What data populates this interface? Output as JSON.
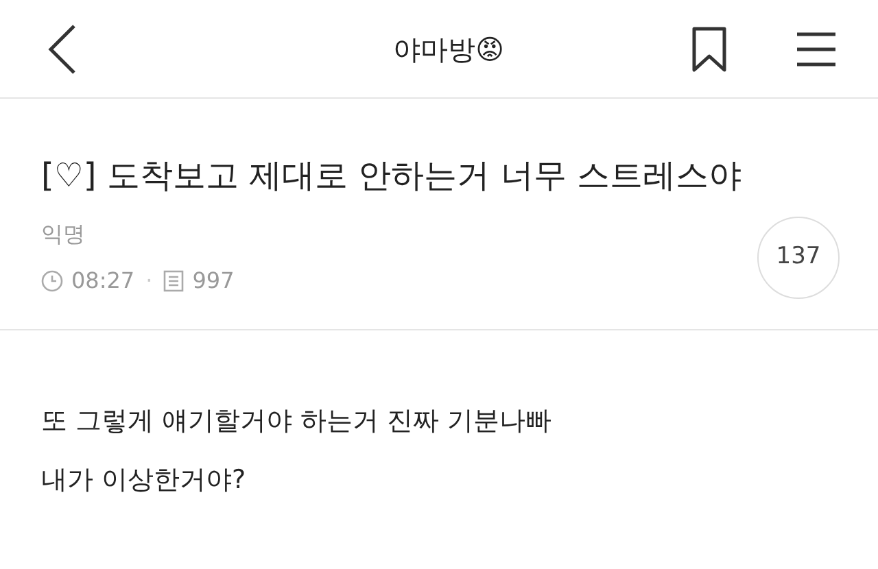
{
  "header": {
    "title": "야마방😡"
  },
  "post": {
    "title": "[♡] 도착보고 제대로 안하는거 너무 스트레스야",
    "author": "익명",
    "time": "08:27",
    "separator": "·",
    "views": "997",
    "comment_count": "137",
    "body": [
      "또 그렇게 얘기할거야 하는거 진짜 기분나빠",
      "내가 이상한거야?"
    ]
  }
}
